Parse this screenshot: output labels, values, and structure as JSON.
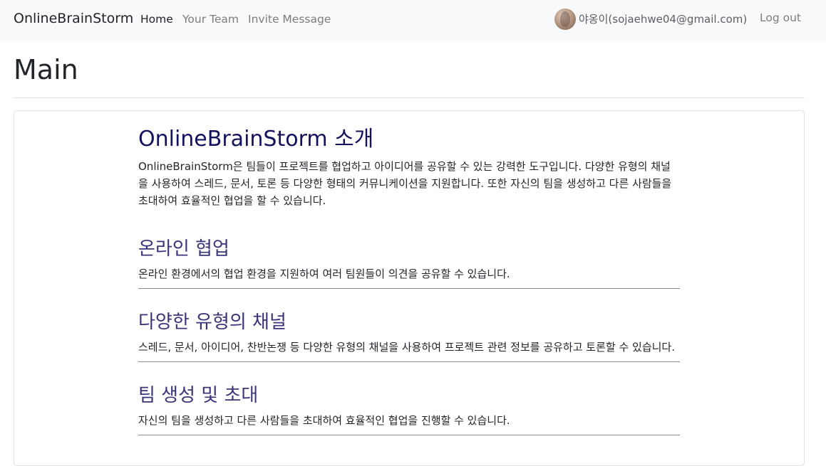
{
  "navbar": {
    "brand": "OnlineBrainStorm",
    "links": [
      {
        "label": "Home",
        "active": true
      },
      {
        "label": "Your Team",
        "active": false
      },
      {
        "label": "Invite Message",
        "active": false
      }
    ],
    "user": "야옹이(sojaehwe04@gmail.com)",
    "logout": "Log out"
  },
  "page": {
    "title": "Main"
  },
  "intro": {
    "heading": "OnlineBrainStorm 소개",
    "text": "OnlineBrainStorm은 팀들이 프로젝트를 협업하고 아이디어를 공유할 수 있는 강력한 도구입니다. 다양한 유형의 채널을 사용하여 스레드, 문서, 토론 등 다양한 형태의 커뮤니케이션을 지원합니다. 또한 자신의 팀을 생성하고 다른 사람들을 초대하여 효율적인 협업을 할 수 있습니다."
  },
  "sections": [
    {
      "heading": "온라인 협업",
      "text": "온라인 환경에서의 협업 환경을 지원하여 여러 팀원들이 의견을 공유할 수 있습니다."
    },
    {
      "heading": "다양한 유형의 채널",
      "text": "스레드, 문서, 아이디어, 찬반논쟁 등 다양한 유형의 채널을 사용하여 프로젝트 관련 정보를 공유하고 토론할 수 있습니다."
    },
    {
      "heading": "팀 생성 및 초대",
      "text": "자신의 팀을 생성하고 다른 사람들을 초대하여 효율적인 협업을 진행할 수 있습니다."
    }
  ],
  "colors": {
    "navbar_bg": "#f8f9fa",
    "intro_heading": "#14125e",
    "section_heading": "#3a347a"
  }
}
